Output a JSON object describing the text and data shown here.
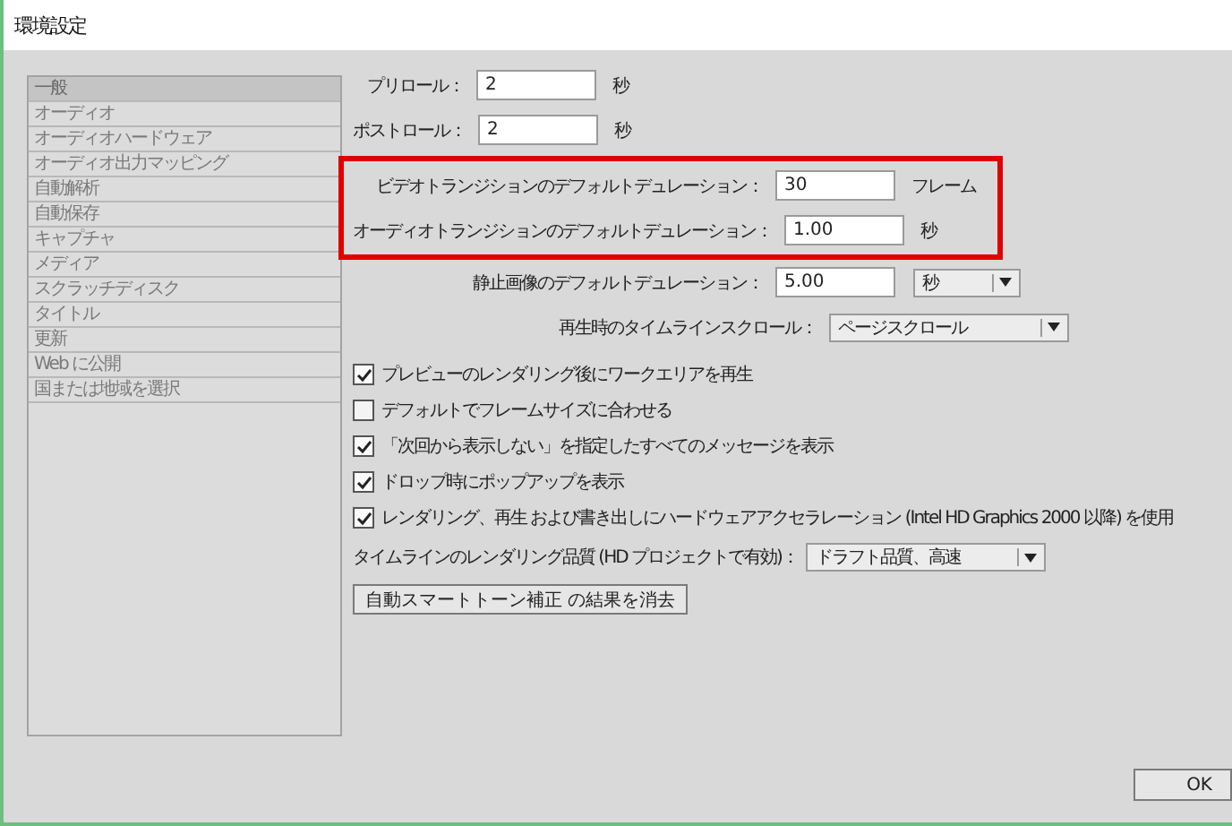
{
  "window": {
    "title": "環境設定"
  },
  "sidebar": {
    "items": [
      {
        "label": "一般",
        "selected": true
      },
      {
        "label": "オーディオ",
        "selected": false
      },
      {
        "label": "オーディオハードウェア",
        "selected": false
      },
      {
        "label": "オーディオ出力マッピング",
        "selected": false
      },
      {
        "label": "自動解析",
        "selected": false
      },
      {
        "label": "自動保存",
        "selected": false
      },
      {
        "label": "キャプチャ",
        "selected": false
      },
      {
        "label": "メディア",
        "selected": false
      },
      {
        "label": "スクラッチディスク",
        "selected": false
      },
      {
        "label": "タイトル",
        "selected": false
      },
      {
        "label": "更新",
        "selected": false
      },
      {
        "label": "Web に公開",
        "selected": false
      },
      {
        "label": "国または地域を選択",
        "selected": false
      }
    ]
  },
  "fields": [
    {
      "kind": "input",
      "label": "プリロール：",
      "value": "2",
      "unit": "秒",
      "highlighted": false
    },
    {
      "kind": "input",
      "label": "ポストロール：",
      "value": "2",
      "unit": "秒",
      "highlighted": false
    },
    {
      "kind": "input",
      "label": "ビデオトランジションのデフォルトデュレーション：",
      "value": "30",
      "unit": "フレーム",
      "highlighted": true
    },
    {
      "kind": "input",
      "label": "オーディオトランジションのデフォルトデュレーション：",
      "value": "1.00",
      "unit": "秒",
      "highlighted": true
    },
    {
      "kind": "input_select",
      "label": "静止画像のデフォルトデュレーション：",
      "value": "5.00",
      "unit": "秒",
      "highlighted": false
    },
    {
      "kind": "select",
      "label": "再生時のタイムラインスクロール：",
      "value": "ページスクロール",
      "highlighted": false
    }
  ],
  "checkboxes": [
    {
      "label": "プレビューのレンダリング後にワークエリアを再生",
      "checked": true
    },
    {
      "label": "デフォルトでフレームサイズに合わせる",
      "checked": false
    },
    {
      "label": "「次回から表示しない」を指定したすべてのメッセージを表示",
      "checked": true
    },
    {
      "label": "ドロップ時にポップアップを表示",
      "checked": true
    },
    {
      "label": "レンダリング、再生 および書き出しにハードウェアアクセラレーション (Intel HD Graphics 2000 以降) を使用",
      "checked": true
    }
  ],
  "quality": {
    "label": "タイムラインのレンダリング品質 (HD プロジェクトで有効)：",
    "value": "ドラフト品質、高速"
  },
  "clear_button": "自動スマートトーン補正 の結果を消去",
  "ok_button": "OK"
}
